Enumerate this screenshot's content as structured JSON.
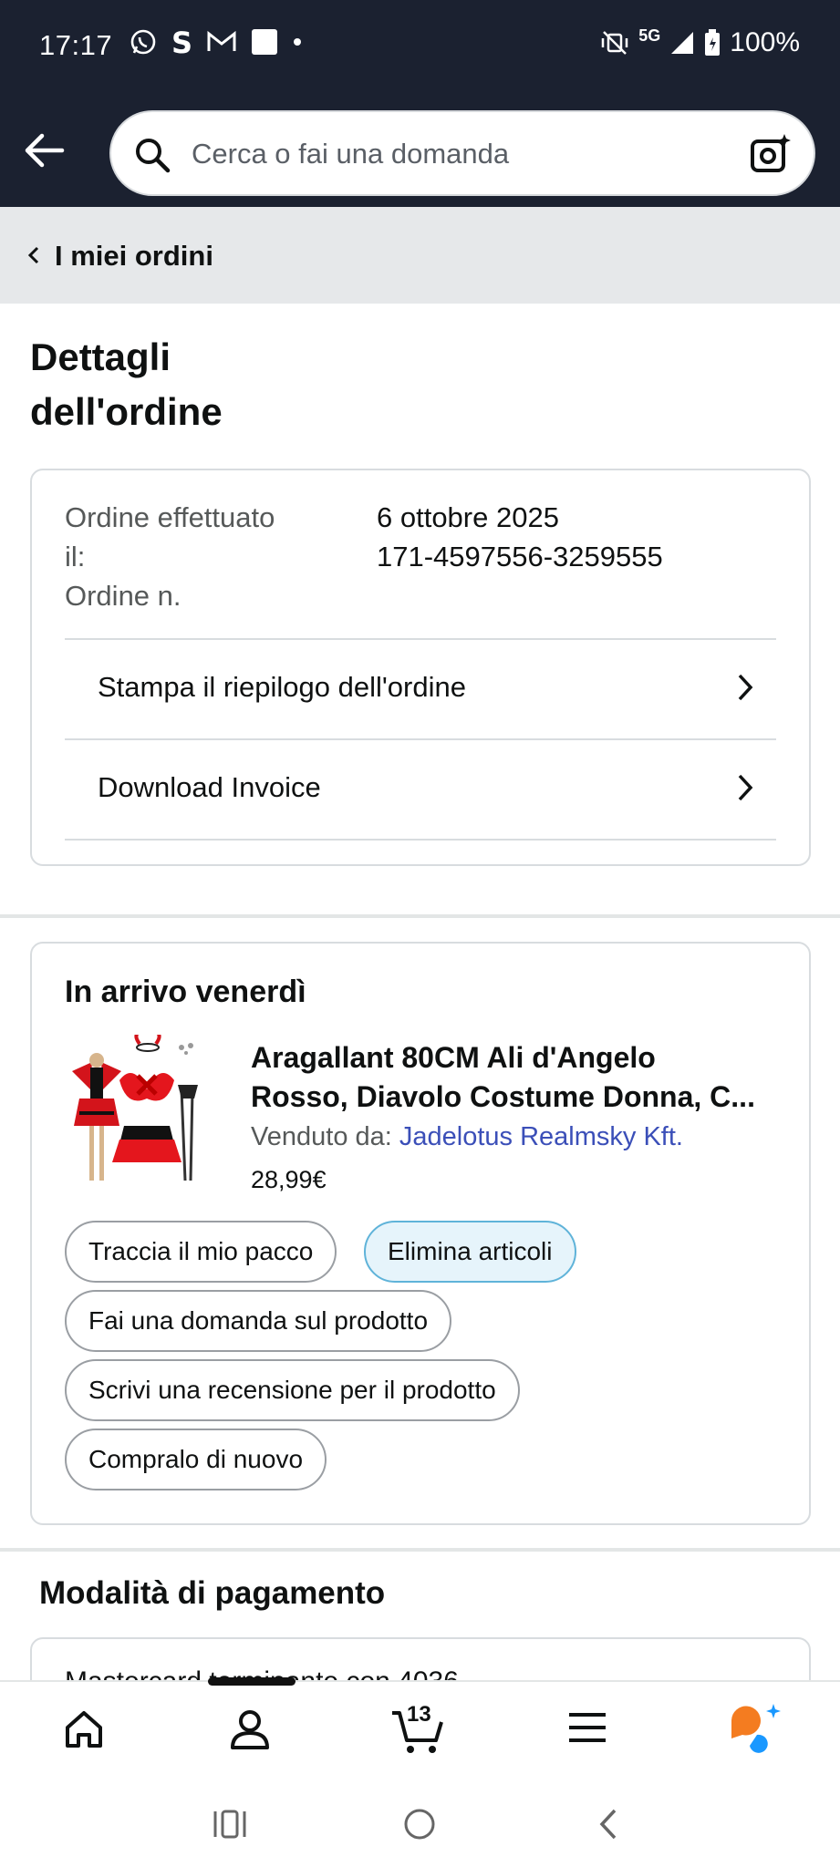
{
  "status_bar": {
    "time": "17:17",
    "network": "5G",
    "battery": "100%"
  },
  "search": {
    "placeholder": "Cerca o fai una domanda"
  },
  "breadcrumb": {
    "label": "I miei ordini"
  },
  "page": {
    "title_line1": "Dettagli",
    "title_line2": "dell'ordine"
  },
  "order": {
    "date_label_line1": "Ordine effettuato",
    "date_label_line2": "il:",
    "number_label": "Ordine n.",
    "date_value": "6 ottobre 2025",
    "number_value": "171-4597556-3259555",
    "links": [
      {
        "label": "Stampa il riepilogo dell'ordine"
      },
      {
        "label": "Download Invoice"
      }
    ]
  },
  "delivery": {
    "heading": "In arrivo venerdì",
    "product": {
      "title_line1": "Aragallant 80CM Ali d'Angelo",
      "title_line2": "Rosso, Diavolo Costume Donna, C...",
      "seller_label": "Venduto da:",
      "seller_name": "Jadelotus Realmsky Kft.",
      "price": "28,99€"
    },
    "actions": [
      {
        "label": "Traccia il mio pacco"
      },
      {
        "label": "Elimina articoli"
      },
      {
        "label": "Fai una domanda sul prodotto"
      },
      {
        "label": "Scrivi una recensione per il prodotto"
      },
      {
        "label": "Compralo di nuovo"
      }
    ]
  },
  "payment": {
    "title": "Modalità di pagamento",
    "card_text": "Mastercard terminante con 4036"
  },
  "bottom_nav": {
    "cart_count": "13"
  },
  "colors": {
    "header_bg": "#1b2130",
    "link": "#3b4fb8",
    "chip_selected_bg": "#e6f4fb",
    "brand_orange": "#f47c20",
    "assistant_blue": "#1a98ff"
  }
}
